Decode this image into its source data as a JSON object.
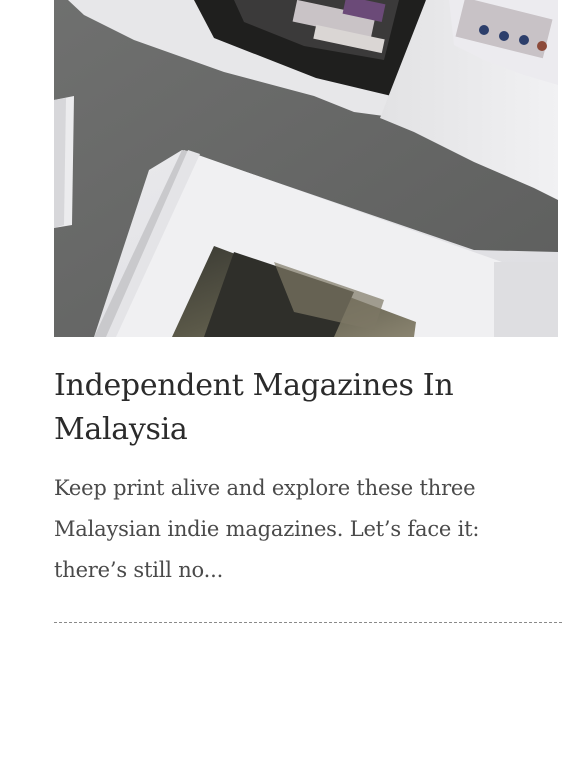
{
  "article": {
    "title": "Independent Magazines In Malaysia",
    "excerpt": "Keep print alive and explore these three Malaysian indie magazines. Let’s face it: there’s still no...",
    "image_alt": "Open magazines on a grey table"
  }
}
